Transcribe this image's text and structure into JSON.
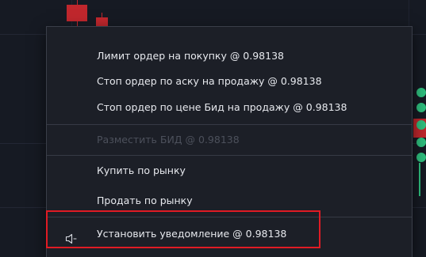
{
  "context_menu": {
    "items": [
      {
        "label": "Лимит ордер на покупку @ 0.98138",
        "enabled": true
      },
      {
        "label": "Стоп ордер по аску на продажу @ 0.98138",
        "enabled": true
      },
      {
        "label": "Стоп ордер по цене Бид на продажу @ 0.98138",
        "enabled": true
      },
      {
        "label": "Разместить БИД @ 0.98138",
        "enabled": false
      },
      {
        "label": "Купить по рынку",
        "enabled": true
      },
      {
        "label": "Продать по рынку",
        "enabled": true
      },
      {
        "label": "Установить уведомление @ 0.98138",
        "enabled": true,
        "icon": "speaker-icon"
      }
    ]
  },
  "colors": {
    "chart_background": "#161a23",
    "menu_background": "#1c1f27",
    "bearish_candle": "#c0272d",
    "bullish_marker": "#2fbf7e",
    "highlight_border": "#e01b24",
    "disabled_text": "#4c505b"
  }
}
